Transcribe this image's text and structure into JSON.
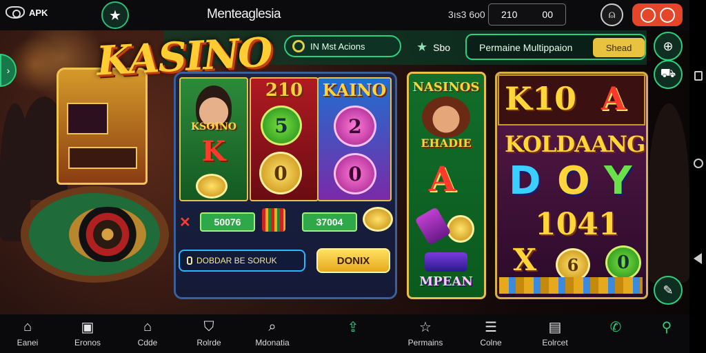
{
  "topbar": {
    "apk_label": "APK",
    "title": "Menteaglesia",
    "balance_label": "3ıs3 6o0",
    "balance_values": [
      "210",
      "00"
    ]
  },
  "logo": {
    "text": "KASINO"
  },
  "promo": {
    "offer_label": "IN Mst Acions",
    "sbo_label": "Sbo",
    "multiplier_label": "Permaine Multippaion",
    "multiplier_button": "Shead"
  },
  "panel": {
    "card1_title": "KSOINO",
    "card1_letter": "K",
    "card2_title": "210",
    "card2_chips": [
      "5",
      "0"
    ],
    "card3_title": "KAINO",
    "card3_chips": [
      "2",
      "0"
    ],
    "bet1": "50076",
    "bet2": "37004",
    "search_placeholder": "DOBDAR BE SORUK",
    "action_button": "DONIX"
  },
  "tall_card": {
    "title": "NASINOS",
    "subtitle": "EHADIE",
    "letter": "A",
    "footer": "MPEAN"
  },
  "frame": {
    "title_k10": "K10",
    "title_a": "A",
    "banner": "KOLDAANG",
    "letters": [
      "D",
      "O",
      "Y"
    ],
    "number": "1041",
    "x_label": "X",
    "coin_6": "6",
    "coin_0": "0"
  },
  "colors": {
    "accent_green": "#2cd07e",
    "gold": "#ffd23d",
    "orange_red": "#e54528"
  },
  "bottomnav": {
    "items": [
      {
        "label": "Eanei",
        "icon": "home-icon"
      },
      {
        "label": "Eronos",
        "icon": "box-icon"
      },
      {
        "label": "Cdde",
        "icon": "house-outline-icon"
      },
      {
        "label": "Rolrde",
        "icon": "gift-icon"
      },
      {
        "label": "Mdonatia",
        "icon": "search-icon"
      },
      {
        "label": "",
        "icon": "upload-icon"
      },
      {
        "label": "Permains",
        "icon": "star-icon"
      },
      {
        "label": "Colne",
        "icon": "menu-icon"
      },
      {
        "label": "Eolrcet",
        "icon": "notes-icon"
      },
      {
        "label": "",
        "icon": "phone-icon"
      },
      {
        "label": "",
        "icon": "magnifier-icon"
      }
    ]
  }
}
